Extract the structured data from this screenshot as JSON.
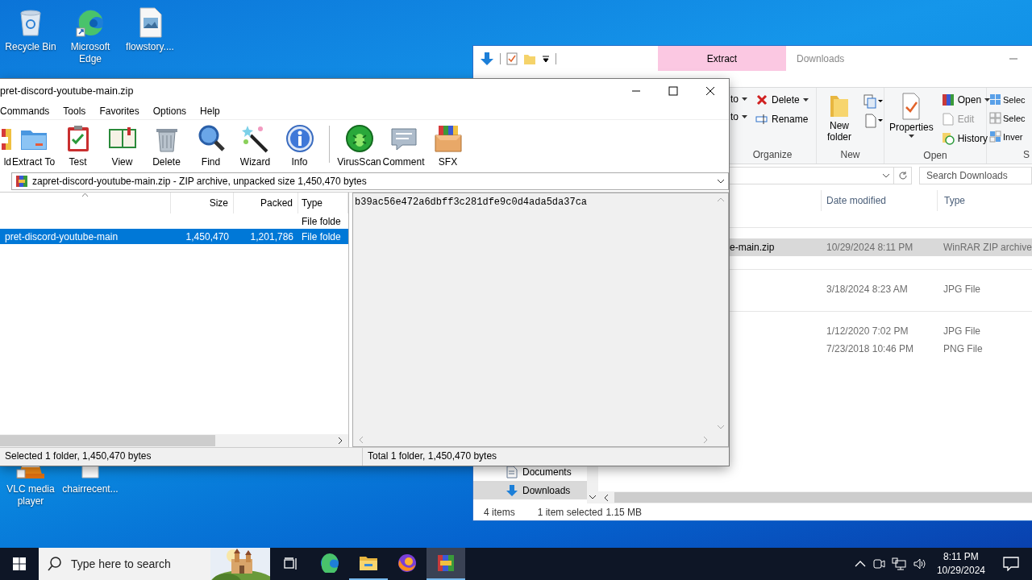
{
  "desktop_icons": [
    {
      "label": "Recycle Bin"
    },
    {
      "label": "Microsoft Edge"
    },
    {
      "label": "flowstory...."
    },
    {
      "label": "VLC media player"
    },
    {
      "label": "chairrecent..."
    }
  ],
  "explorer": {
    "title": "Downloads",
    "context_tab": "Extract",
    "organize": {
      "label": "Organize",
      "items": [
        {
          "label": "to",
          "dropdown": true
        },
        {
          "label": "to",
          "dropdown": true
        },
        {
          "label": "Delete",
          "dropdown": true
        },
        {
          "label": "Rename",
          "dropdown": false
        }
      ]
    },
    "new": {
      "label": "New",
      "button": "New folder"
    },
    "open": {
      "label": "Open",
      "button": "Properties",
      "items": [
        {
          "label": "Open",
          "disabled": false,
          "dropdown": true
        },
        {
          "label": "Edit",
          "disabled": true,
          "dropdown": false
        },
        {
          "label": "History",
          "disabled": false,
          "dropdown": false
        }
      ]
    },
    "select": {
      "label": "S",
      "items": [
        "Selec",
        "Selec",
        "Inver"
      ]
    },
    "search": {
      "placeholder": "Search Downloads"
    },
    "columns": [
      "Date modified",
      "Type"
    ],
    "groups": [
      {
        "rows": [
          {
            "name": "e-main.zip",
            "date": "10/29/2024 8:11 PM",
            "type": "WinRAR ZIP archive",
            "selected": true
          }
        ]
      },
      {
        "rows": [
          {
            "date": "3/18/2024 8:23 AM",
            "type": "JPG File",
            "selected": false
          }
        ]
      },
      {
        "rows": [
          {
            "date": "1/12/2020 7:02 PM",
            "type": "JPG File",
            "selected": false
          },
          {
            "date": "7/23/2018 10:46 PM",
            "type": "PNG File",
            "selected": false
          }
        ]
      }
    ],
    "nav": [
      {
        "label": "Documents",
        "selected": false
      },
      {
        "label": "Downloads",
        "selected": true
      }
    ],
    "status": {
      "count": "4 items",
      "selection": "1 item selected",
      "size": "1.15 MB"
    }
  },
  "winrar": {
    "title": "pret-discord-youtube-main.zip",
    "menu": [
      "Commands",
      "Tools",
      "Favorites",
      "Options",
      "Help"
    ],
    "toolbar": [
      [
        "ld",
        "Extract To",
        "Test",
        "View",
        "Delete",
        "Find",
        "Wizard",
        "Info"
      ],
      [
        "VirusScan",
        "Comment",
        "SFX"
      ]
    ],
    "path": "zapret-discord-youtube-main.zip - ZIP archive, unpacked size 1,450,470 bytes",
    "columns": [
      "Size",
      "Packed",
      "Type"
    ],
    "rows": [
      {
        "type": "File folde",
        "selected": false
      },
      {
        "name": "pret-discord-youtube-main",
        "size": "1,450,470",
        "packed": "1,201,786",
        "type": "File folde",
        "selected": true
      }
    ],
    "comment": "b39ac56e472a6dbff3c281dfe9c0d4ada5da37ca",
    "status": [
      "Selected 1 folder, 1,450,470 bytes",
      "Total 1 folder, 1,450,470 bytes"
    ]
  },
  "taskbar": {
    "search": {
      "placeholder": "Type here to search"
    },
    "apps": [
      {
        "running": false,
        "active": false
      },
      {
        "running": true,
        "active": false
      },
      {
        "running": false,
        "active": false
      },
      {
        "running": true,
        "active": true
      }
    ],
    "clock": {
      "time": "8:11 PM",
      "date": "10/29/2024"
    }
  }
}
